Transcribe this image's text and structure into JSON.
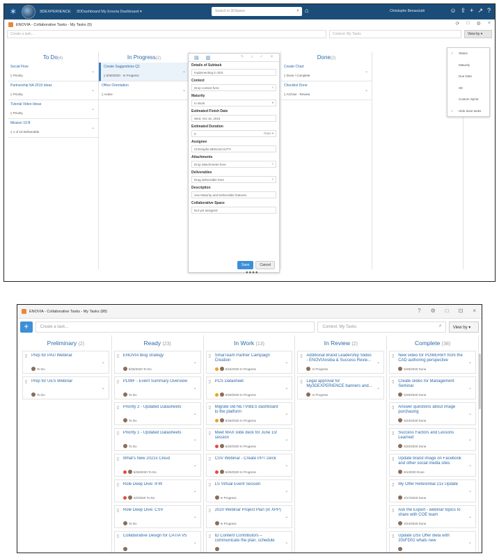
{
  "top": {
    "title": {
      "brand": "3DEXPERIENCE",
      "dashboard": "3DDashboard  My Enovia Dashboard  ▾"
    },
    "search_placeholder": "Search in 3DSpace",
    "user": "Christophe Benasciutti",
    "widget_title": "ENOVIA - Collaborative Tasks - My Tasks (9)",
    "create_placeholder": "Create a task...",
    "context_placeholder": "Context: My Tasks",
    "view_by": "View by  ▾",
    "columns": [
      {
        "title": "To Do",
        "count": "(4)",
        "cards": [
          {
            "title": "Social Flow",
            "meta": "Priority"
          },
          {
            "title": "Partnership NA 2019 Ideas",
            "meta": "Priority"
          },
          {
            "title": "Tutorial Video Ideas",
            "meta": "Priority"
          },
          {
            "title": "Mission 19 B",
            "meta": "1 of 10 Deliverable"
          }
        ]
      },
      {
        "title": "In Progress",
        "count": "(2)",
        "cards": [
          {
            "title": "Create Suggestions Q1",
            "meta": "5/30/2020 · In Progress"
          },
          {
            "title": "Office Orientation",
            "meta": "Active"
          }
        ]
      },
      {
        "title": "",
        "count": "",
        "cards": []
      },
      {
        "title": "Done",
        "count": "(2)",
        "cards": [
          {
            "title": "Create Chart",
            "meta": "Done / Complete"
          },
          {
            "title": "Checklist Done",
            "meta": "Archive · Review"
          }
        ]
      },
      {
        "title": "",
        "count": "",
        "cards": []
      }
    ],
    "panel": {
      "fields": [
        {
          "label": "Details of Subtask",
          "value": "Implementing in 3DX"
        },
        {
          "label": "Context",
          "value": "Drop context here"
        },
        {
          "label": "Maturity",
          "value": "In Work"
        },
        {
          "label": "Estimated Finish Date",
          "value": "Wed, Oct 16, 2019"
        },
        {
          "label": "Estimated Duration",
          "value": "0",
          "unit": "Days"
        },
        {
          "label": "Assignee",
          "value": "Christophe BENASCIUTTI"
        },
        {
          "label": "Attachments",
          "value": "Drop attachments here"
        },
        {
          "label": "Deliverables",
          "value": "Drag deliverable here"
        },
        {
          "label": "Description",
          "value": "Use Maturity and Deliverable features"
        },
        {
          "label": "Collaborative Space",
          "value": "Not yet assigned"
        }
      ],
      "save": "Save",
      "cancel": "Cancel"
    },
    "dropdown": [
      {
        "label": "Status",
        "checked": true
      },
      {
        "label": "Maturity",
        "checked": false
      },
      {
        "label": "Due Date",
        "checked": false
      },
      {
        "label": "3D",
        "checked": false
      },
      {
        "label": "Custom Sprint",
        "checked": false
      },
      {
        "label": "Hide done tasks",
        "checked": true
      }
    ],
    "pager": "●●●●"
  },
  "bottom": {
    "title": "ENOVIA - Collaborative Tasks - My Tasks (88)",
    "create_placeholder": "Create a task...",
    "context_placeholder": "Context: My Tasks",
    "view_by": "View by  ▾",
    "columns": [
      {
        "title": "Preliminary",
        "count": "(2)",
        "cards": [
          {
            "title": "Prep for PAU Webinar",
            "meta": "To Do"
          },
          {
            "title": "Prep for UES Webinar",
            "meta": "To Do"
          }
        ]
      },
      {
        "title": "Ready",
        "count": "(23)",
        "cards": [
          {
            "title": "ENOVIA blog strategy",
            "meta": "5/26/2020  To Do"
          },
          {
            "title": "PLMIF - Event Summary Overview",
            "meta": "To Do"
          },
          {
            "title": "Priority 2 - Updated Datasheets",
            "meta": "To Do"
          },
          {
            "title": "Priority 1 - Updated Datasheets",
            "meta": "To Do"
          },
          {
            "title": "What's New 2021x Cloud",
            "meta": "6/26/2020  To Do",
            "dot": "#e84c3d"
          },
          {
            "title": "Role Deep Dive: IFW",
            "meta": "4/2/2020  To Do",
            "dot": "#e84c3d"
          },
          {
            "title": "Role Deep Dive: CSV",
            "meta": "To Do"
          },
          {
            "title": "Collaborative Design for CATIA V5",
            "meta": ""
          }
        ]
      },
      {
        "title": "In Work",
        "count": "(13)",
        "cards": [
          {
            "title": "SmarTeam Partner Campaign Creation",
            "meta": "6/15/2020  In Progress",
            "dot": "#f0a020"
          },
          {
            "title": "PCS Datasheet",
            "meta": "6/20/2020  In Progress",
            "dot": "#f0a020"
          },
          {
            "title": "Migrate old NETVIBES dashboard to the platform",
            "meta": "5/26/2020  In Progress",
            "dot": "#f0a020"
          },
          {
            "title": "Meet MAX slide deck for June 1st session",
            "meta": "6/20/2020  In Progress",
            "dot": "#e84c3d"
          },
          {
            "title": "CSV Webinar - Create PPT Deck",
            "meta": "6/20/2020  In Progress",
            "dot": "#e84c3d"
          },
          {
            "title": "LS Virtual Event Session",
            "meta": "In Progress"
          },
          {
            "title": "2020 Webinar Project Plan (in XPP)",
            "meta": "In Progress"
          },
          {
            "title": "ID Content Contributors – communicate the plan, schedule",
            "meta": ""
          }
        ]
      },
      {
        "title": "In Review",
        "count": "(2)",
        "cards": [
          {
            "title": "Additional Brand Leadership Slides - ENOVIAnsiba & Success Revie...",
            "meta": "In Progress"
          },
          {
            "title": "Legal approval for My3DEXPERIENCE banners and...",
            "meta": "In Progress"
          }
        ]
      },
      {
        "title": "Complete",
        "count": "(38)",
        "cards": [
          {
            "title": "New video for POWERBY from the CAD authoring perspective",
            "meta": "5/29/2020  Done"
          },
          {
            "title": "Create slides for Management Seminar",
            "meta": "5/29/2020  Done"
          },
          {
            "title": "Answer questions about image purchasing",
            "meta": "5/23/2020  Done"
          },
          {
            "title": "Success Factors and Lessons Learned",
            "meta": "5/20/2020  Done"
          },
          {
            "title": "Update brand image on Facebook and other social media sites",
            "meta": "6/1/2020  Done"
          },
          {
            "title": "My Offer Referential 21x Update",
            "meta": "4/17/2020  Done"
          },
          {
            "title": "Ask the Expert - webinar topics to share with COE team",
            "meta": "4/24/2020  Done"
          },
          {
            "title": "Update DSx Offer Beta with 20xFD01 whats new",
            "meta": ""
          }
        ]
      }
    ]
  }
}
